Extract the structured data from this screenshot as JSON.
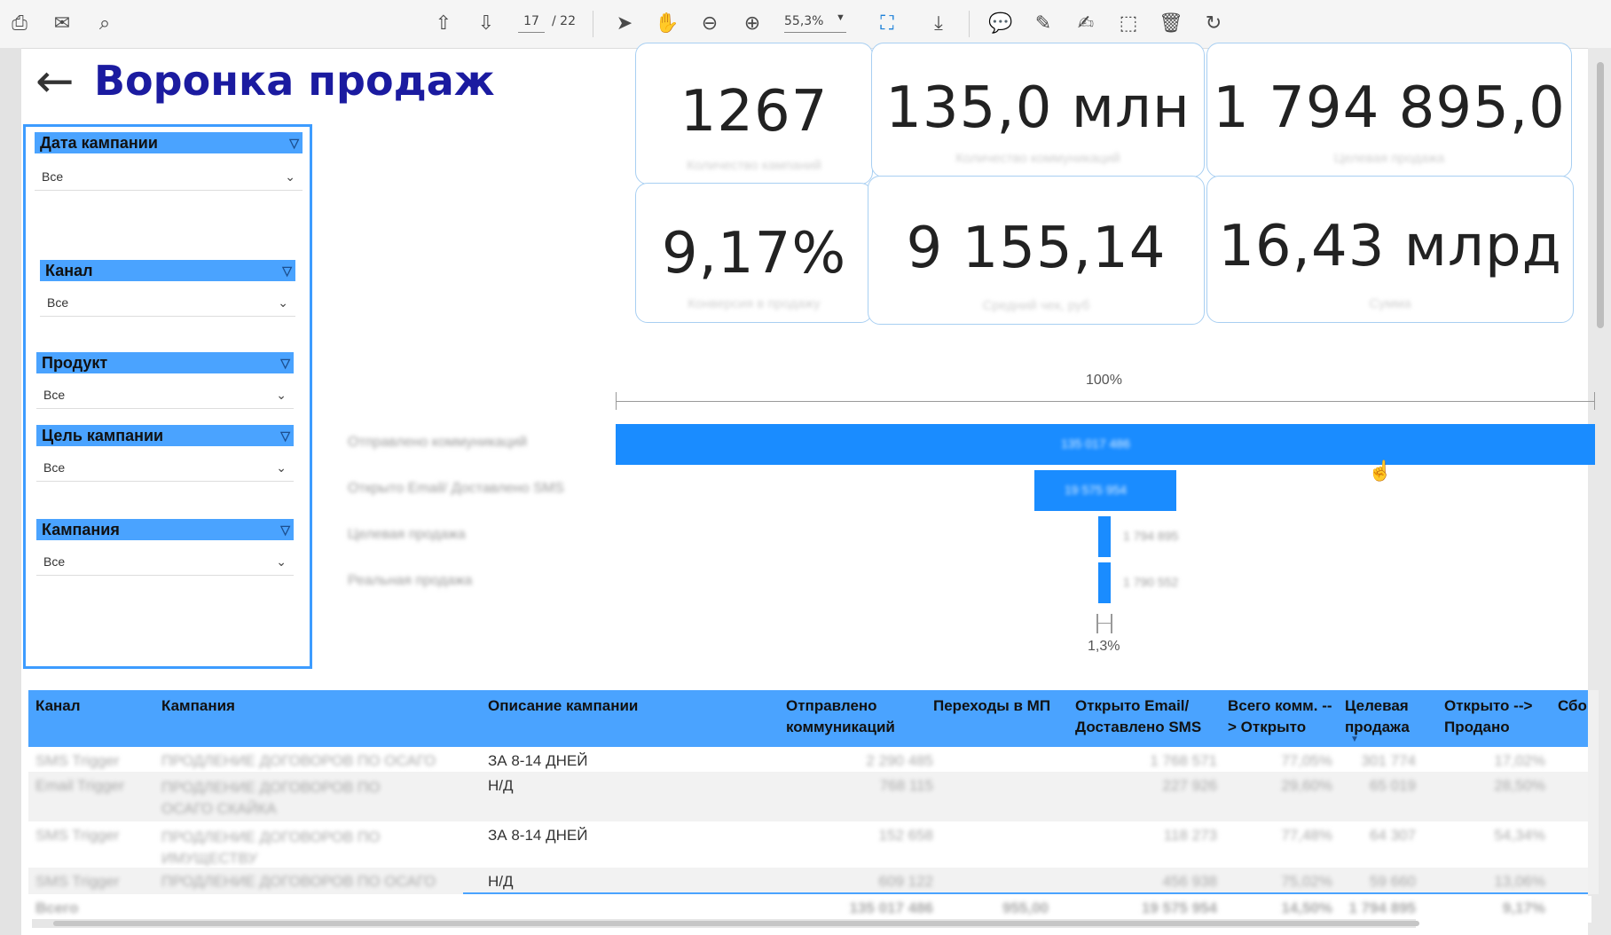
{
  "toolbar": {
    "page_current": "17",
    "page_total": "/ 22",
    "zoom": "55,3%"
  },
  "page": {
    "title": "Воронка продаж"
  },
  "filters": [
    {
      "label": "Дата кампании",
      "value": "Все"
    },
    {
      "label": "Канал",
      "value": "Все"
    },
    {
      "label": "Продукт",
      "value": "Все"
    },
    {
      "label": "Цель кампании",
      "value": "Все"
    },
    {
      "label": "Кампания",
      "value": "Все"
    }
  ],
  "kpis": [
    {
      "value": "1267",
      "label": "Количество кампаний"
    },
    {
      "value": "135,0 млн",
      "label": "Количество коммуникаций"
    },
    {
      "value": "1 794 895,0",
      "label": "Целевая продажа"
    },
    {
      "value": "9,17%",
      "label": "Конверсия в продажу"
    },
    {
      "value": "9 155,14",
      "label": "Средний чек, руб"
    },
    {
      "value": "16,43 млрд",
      "label": "Сумма"
    }
  ],
  "funnel": {
    "top_pct": "100%",
    "bottom_pct": "1,3%",
    "stages": [
      {
        "label": "Отправлено коммуникаций",
        "value": "135 017 486"
      },
      {
        "label": "Открыто Email/ Доставлено SMS",
        "value": "19 575 954"
      },
      {
        "label": "Целевая продажа",
        "value": "1 794 895"
      },
      {
        "label": "Реальная продажа",
        "value": "1 790 552"
      }
    ]
  },
  "table": {
    "columns": [
      "Канал",
      "Кампания",
      "Описание кампании",
      "Отправлено коммуникаций",
      "Переходы в МП",
      "Открыто Email/ Доставлено SMS",
      "Всего комм. --> Открыто",
      "Целевая продажа",
      "Открыто --> Продано",
      "Сбо"
    ],
    "rows": [
      {
        "channel": "SMS Trigger",
        "campaign": "ПРОДЛЕНИЕ ДОГОВОРОВ ПО ОСАГО",
        "description": "ЗА 8-14 ДНЕЙ",
        "sent": "2 290 485",
        "transitions": "",
        "opened": "1 768 571",
        "rate_open": "77,05%",
        "target_sale": "301 774",
        "rate_sold": "17,02%"
      },
      {
        "channel": "Email Trigger",
        "campaign": "ПРОДЛЕНИЕ ДОГОВОРОВ ПО ОСАГО СКАЙКА",
        "description": "Н/Д",
        "sent": "768 115",
        "transitions": "",
        "opened": "227 926",
        "rate_open": "29,60%",
        "target_sale": "65 019",
        "rate_sold": "28,50%"
      },
      {
        "channel": "SMS Trigger",
        "campaign": "ПРОДЛЕНИЕ ДОГОВОРОВ ПО ИМУЩЕСТВУ",
        "description": "ЗА 8-14 ДНЕЙ",
        "sent": "152 658",
        "transitions": "",
        "opened": "118 273",
        "rate_open": "77,48%",
        "target_sale": "64 307",
        "rate_sold": "54,34%"
      },
      {
        "channel": "SMS Trigger",
        "campaign": "ПРОДЛЕНИЕ ДОГОВОРОВ ПО ОСАГО",
        "description": "Н/Д",
        "sent": "609 122",
        "transitions": "",
        "opened": "456 938",
        "rate_open": "75,02%",
        "target_sale": "59 660",
        "rate_sold": "13,06%"
      }
    ],
    "total": {
      "label": "Всего",
      "sent": "135 017 486",
      "transitions": "955,00",
      "opened": "19 575 954",
      "rate_open": "14,50%",
      "target_sale": "1 794 895",
      "rate_sold": "9,17%"
    }
  }
}
